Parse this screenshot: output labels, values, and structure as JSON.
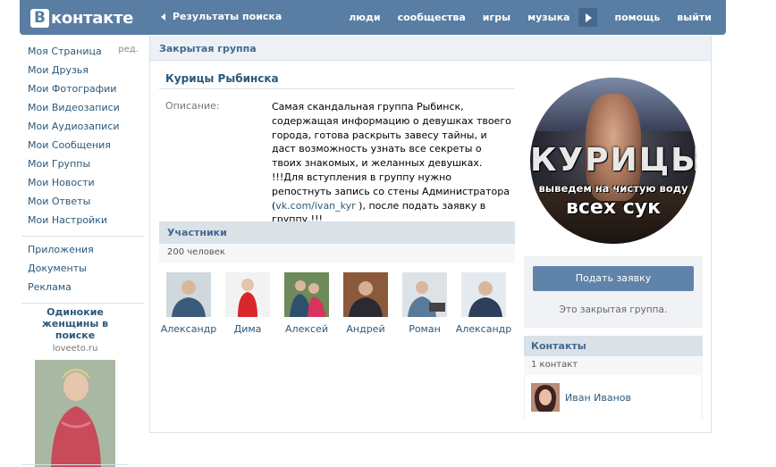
{
  "header": {
    "logo_letter": "В",
    "logo_word": "контакте",
    "back_label": "Результаты поиска",
    "nav": [
      "люди",
      "сообщества",
      "игры",
      "музыка",
      "помощь",
      "выйти"
    ]
  },
  "leftmenu": {
    "items": [
      "Моя Страница",
      "Мои Друзья",
      "Мои Фотографии",
      "Мои Видеозаписи",
      "Мои Аудиозаписи",
      "Мои Сообщения",
      "Мои Группы",
      "Мои Новости",
      "Мои Ответы",
      "Мои Настройки"
    ],
    "edit_label": "ред.",
    "extra": [
      "Приложения",
      "Документы",
      "Реклама"
    ]
  },
  "ad": {
    "title": "Одинокие женщины в поиске",
    "domain": "loveeto.ru"
  },
  "group": {
    "type_label": "Закрытая группа",
    "name": "Курицы Рыбинска",
    "desc_label": "Описание:",
    "desc_main": "Самая скандальная группа Рыбинск, содержащая информацию о девушках твоего города, готова раскрыть завесу тайны, и даст возможность узнать все секреты о твоих знакомых, и желанных девушках.",
    "desc_join_before": "!!!Для вступления в группу нужно репостнуть запись со стены Администратора (",
    "desc_link": "vk.com/ivan_kyr",
    "desc_join_after": " ), после подать заявку в группу.!!!",
    "avatar_line1": "КУРИЦЫ",
    "avatar_line2": "выведем на чистую воду",
    "avatar_line3": "всех сук"
  },
  "members": {
    "header": "Участники",
    "count": "200 человек",
    "list": [
      "Александр",
      "Дима",
      "Алексей",
      "Андрей",
      "Роман",
      "Александр"
    ]
  },
  "join": {
    "button": "Подать заявку",
    "note": "Это закрытая группа."
  },
  "contacts": {
    "header": "Контакты",
    "count": "1 контакт",
    "name": "Иван Иванов"
  },
  "colors": {
    "header_bg": "#597da3",
    "link": "#2b587a",
    "button": "#6083a9"
  }
}
